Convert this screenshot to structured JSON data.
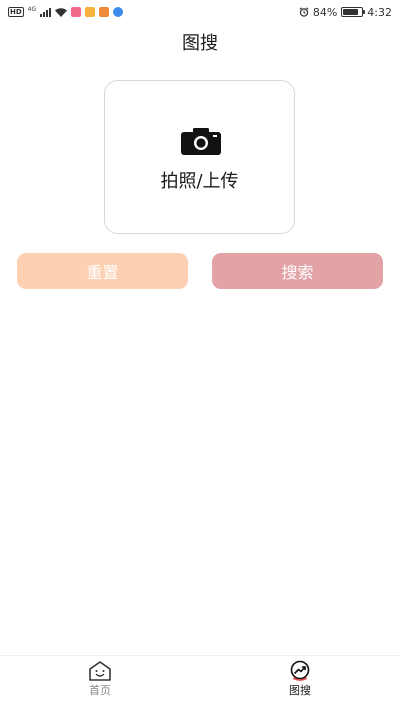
{
  "status_bar": {
    "hd": "HD",
    "network": "4G",
    "battery_text": "84%",
    "battery_level": 0.84,
    "time": "4:32",
    "app_icon_colors": [
      "#f06a8c",
      "#f5b23c",
      "#f08a3c",
      "#3c8cf0"
    ]
  },
  "header": {
    "title": "图搜"
  },
  "upload": {
    "label": "拍照/上传",
    "icon": "camera-icon"
  },
  "actions": {
    "reset_label": "重置",
    "search_label": "搜索"
  },
  "tab_bar": {
    "items": [
      {
        "label": "首页",
        "icon": "home-icon",
        "active": false
      },
      {
        "label": "图搜",
        "icon": "image-search-icon",
        "active": true
      }
    ]
  },
  "colors": {
    "reset_button": "#fdd0b1",
    "search_button": "#e3a3a6",
    "tab_inactive": "#888888",
    "tab_active": "#1a1a1a"
  }
}
